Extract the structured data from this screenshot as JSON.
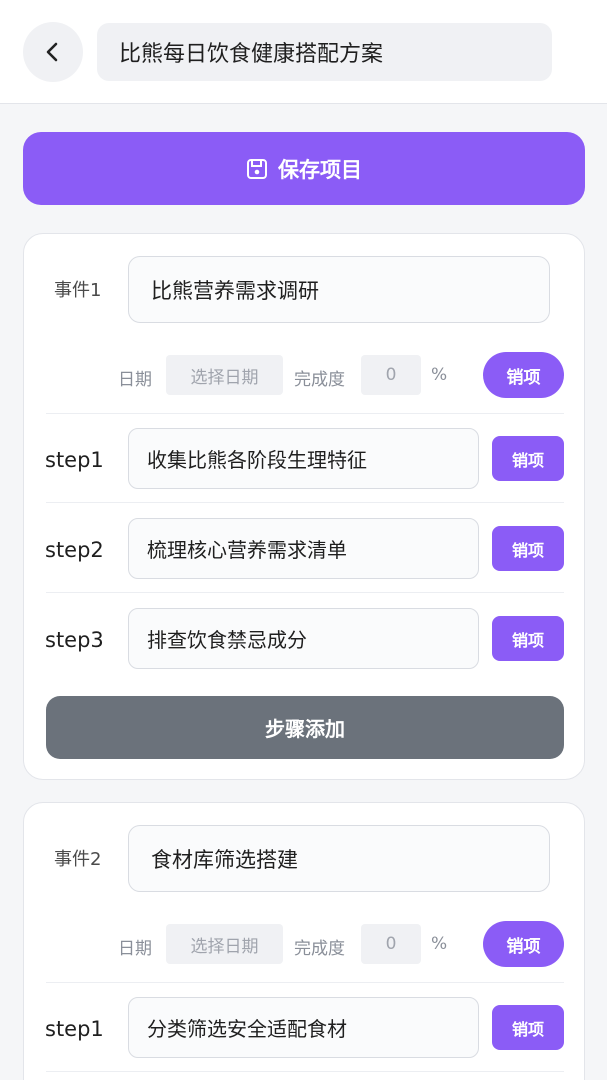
{
  "header": {
    "back_icon": "chevron-left-icon",
    "title": "比熊每日饮食健康搭配方案"
  },
  "toolbar": {
    "save_icon": "floppy-disk-icon",
    "save_label": "保存项目"
  },
  "events": [
    {
      "label": "事件1",
      "name": "比熊营养需求调研",
      "date_label": "日期",
      "date_placeholder": "选择日期",
      "progress_label": "完成度",
      "progress_value": "0",
      "percent_sign": "%",
      "delete_label": "销项",
      "steps": [
        {
          "label": "step1",
          "text": "收集比熊各阶段生理特征",
          "delete_label": "销项"
        },
        {
          "label": "step2",
          "text": "梳理核心营养需求清单",
          "delete_label": "销项"
        },
        {
          "label": "step3",
          "text": "排查饮食禁忌成分",
          "delete_label": "销项"
        }
      ],
      "add_step_label": "步骤添加"
    },
    {
      "label": "事件2",
      "name": "食材库筛选搭建",
      "date_label": "日期",
      "date_placeholder": "选择日期",
      "progress_label": "完成度",
      "progress_value": "0",
      "percent_sign": "%",
      "delete_label": "销项",
      "steps": [
        {
          "label": "step1",
          "text": "分类筛选安全适配食材",
          "delete_label": "销项"
        }
      ]
    }
  ],
  "colors": {
    "accent": "#8b5cf6",
    "secondary_button": "#6b727b"
  }
}
